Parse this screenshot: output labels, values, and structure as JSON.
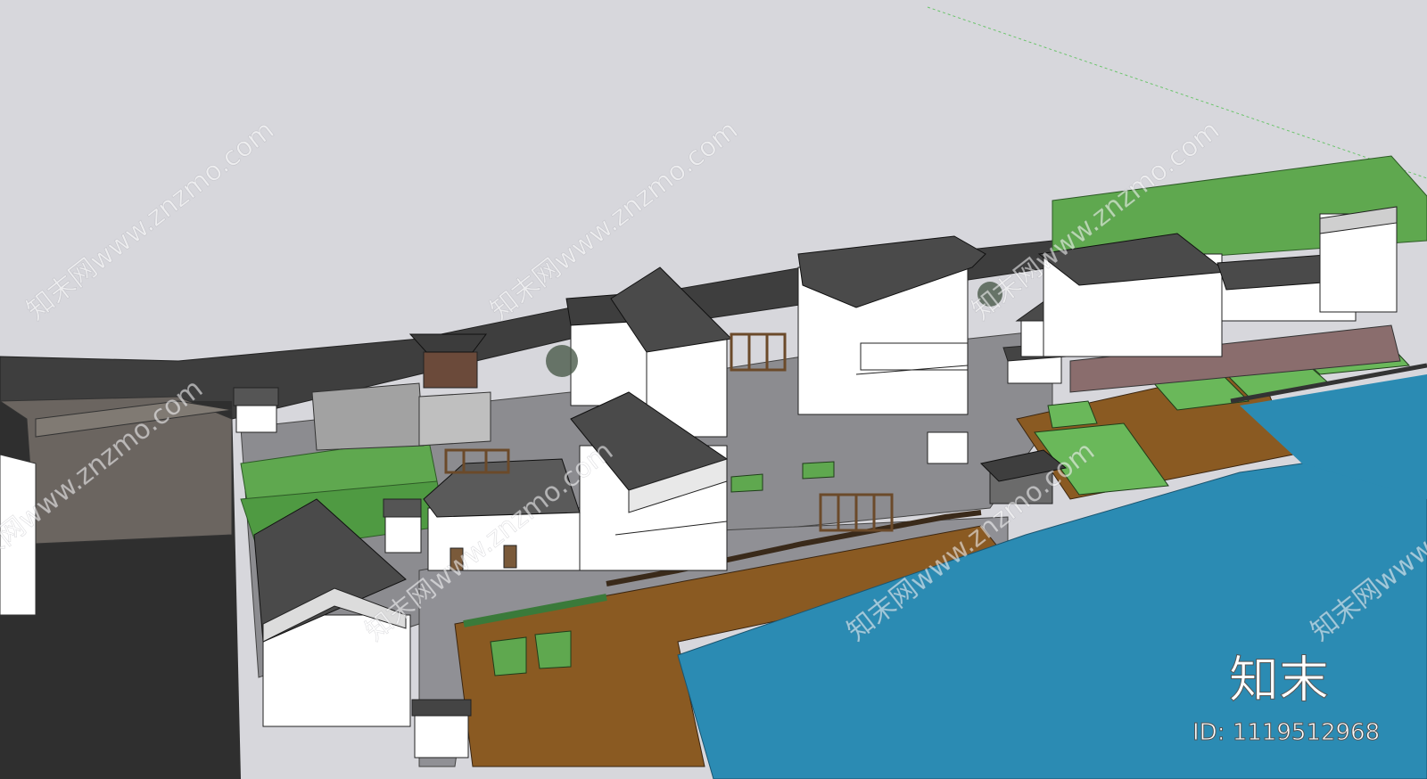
{
  "watermark": {
    "repeat_text": "知末网www.znzmo.com",
    "brand": "知末",
    "id_text": "ID: 1119512968"
  },
  "colors": {
    "sky": "#d7d7dc",
    "water": "#2b8bb3",
    "deck": "#8a5a22",
    "grass": "#5fa84f",
    "roof": "#4a4a4a",
    "wall": "#ffffff",
    "ground": "#8c8c90"
  }
}
